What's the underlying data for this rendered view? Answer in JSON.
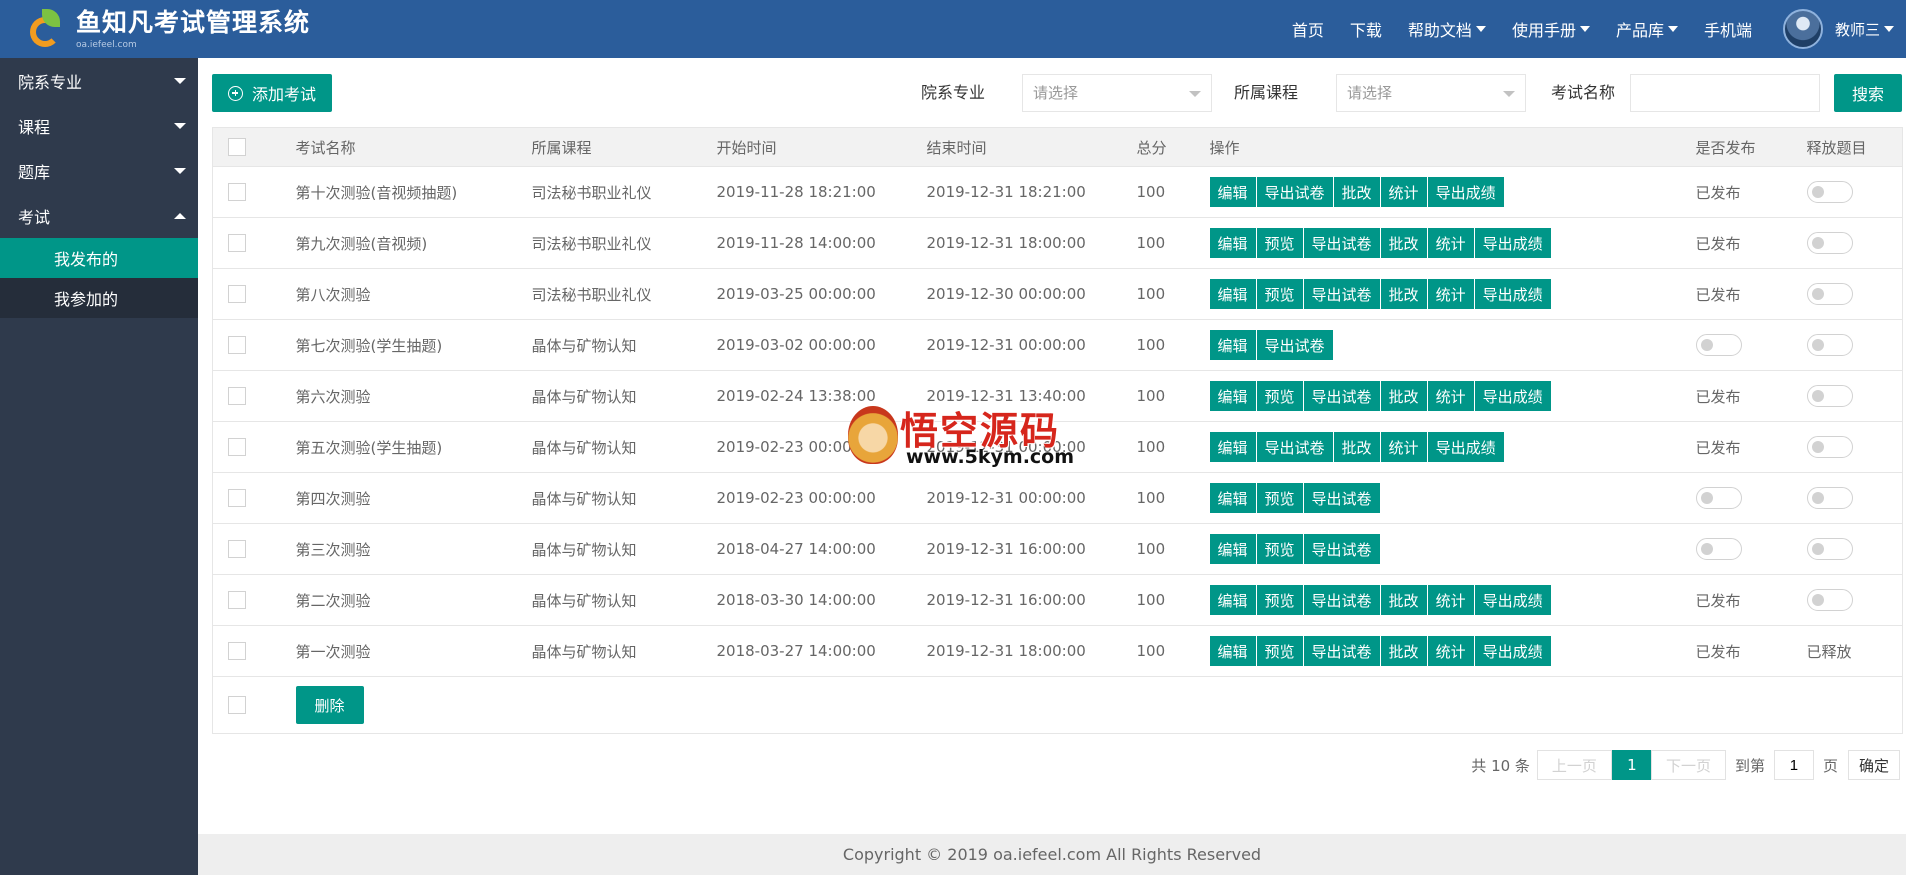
{
  "header": {
    "app_title": "鱼知凡考试管理系统",
    "app_subtitle": "oa.iefeel.com",
    "nav": [
      {
        "label": "首页",
        "dropdown": false
      },
      {
        "label": "下载",
        "dropdown": false
      },
      {
        "label": "帮助文档",
        "dropdown": true
      },
      {
        "label": "使用手册",
        "dropdown": true
      },
      {
        "label": "产品库",
        "dropdown": true
      },
      {
        "label": "手机端",
        "dropdown": false
      }
    ],
    "user_name": "教师三"
  },
  "sidebar": {
    "groups": [
      {
        "label": "院系专业",
        "expanded": false
      },
      {
        "label": "课程",
        "expanded": false
      },
      {
        "label": "题库",
        "expanded": false
      },
      {
        "label": "考试",
        "expanded": true
      }
    ],
    "sub_items": [
      {
        "label": "我发布的",
        "active": true
      },
      {
        "label": "我参加的",
        "active": false
      }
    ]
  },
  "toolbar": {
    "add_label": "添加考试",
    "dept_label": "院系专业",
    "dept_placeholder": "请选择",
    "course_label": "所属课程",
    "course_placeholder": "请选择",
    "name_label": "考试名称",
    "name_value": "",
    "search_label": "搜索"
  },
  "table": {
    "headers": [
      "考试名称",
      "所属课程",
      "开始时间",
      "结束时间",
      "总分",
      "操作",
      "是否发布",
      "释放题目"
    ],
    "rows": [
      {
        "name": "第十次测验(音视频抽题)",
        "course": "司法秘书职业礼仪",
        "start": "2019-11-28 18:21:00",
        "end": "2019-12-31 18:21:00",
        "score": "100",
        "ops": [
          "编辑",
          "导出试卷",
          "批改",
          "统计",
          "导出成绩"
        ],
        "published": "已发布",
        "released": ""
      },
      {
        "name": "第九次测验(音视频)",
        "course": "司法秘书职业礼仪",
        "start": "2019-11-28 14:00:00",
        "end": "2019-12-31 18:00:00",
        "score": "100",
        "ops": [
          "编辑",
          "预览",
          "导出试卷",
          "批改",
          "统计",
          "导出成绩"
        ],
        "published": "已发布",
        "released": ""
      },
      {
        "name": "第八次测验",
        "course": "司法秘书职业礼仪",
        "start": "2019-03-25 00:00:00",
        "end": "2019-12-30 00:00:00",
        "score": "100",
        "ops": [
          "编辑",
          "预览",
          "导出试卷",
          "批改",
          "统计",
          "导出成绩"
        ],
        "published": "已发布",
        "released": ""
      },
      {
        "name": "第七次测验(学生抽题)",
        "course": "晶体与矿物认知",
        "start": "2019-03-02 00:00:00",
        "end": "2019-12-31 00:00:00",
        "score": "100",
        "ops": [
          "编辑",
          "导出试卷"
        ],
        "published": "",
        "released": ""
      },
      {
        "name": "第六次测验",
        "course": "晶体与矿物认知",
        "start": "2019-02-24 13:38:00",
        "end": "2019-12-31 13:40:00",
        "score": "100",
        "ops": [
          "编辑",
          "预览",
          "导出试卷",
          "批改",
          "统计",
          "导出成绩"
        ],
        "published": "已发布",
        "released": ""
      },
      {
        "name": "第五次测验(学生抽题)",
        "course": "晶体与矿物认知",
        "start": "2019-02-23 00:00:00",
        "end": "2019-12-31 00:00:00",
        "score": "100",
        "ops": [
          "编辑",
          "导出试卷",
          "批改",
          "统计",
          "导出成绩"
        ],
        "published": "已发布",
        "released": ""
      },
      {
        "name": "第四次测验",
        "course": "晶体与矿物认知",
        "start": "2019-02-23 00:00:00",
        "end": "2019-12-31 00:00:00",
        "score": "100",
        "ops": [
          "编辑",
          "预览",
          "导出试卷"
        ],
        "published": "",
        "released": ""
      },
      {
        "name": "第三次测验",
        "course": "晶体与矿物认知",
        "start": "2018-04-27 14:00:00",
        "end": "2019-12-31 16:00:00",
        "score": "100",
        "ops": [
          "编辑",
          "预览",
          "导出试卷"
        ],
        "published": "",
        "released": ""
      },
      {
        "name": "第二次测验",
        "course": "晶体与矿物认知",
        "start": "2018-03-30 14:00:00",
        "end": "2019-12-31 16:00:00",
        "score": "100",
        "ops": [
          "编辑",
          "预览",
          "导出试卷",
          "批改",
          "统计",
          "导出成绩"
        ],
        "published": "已发布",
        "released": ""
      },
      {
        "name": "第一次测验",
        "course": "晶体与矿物认知",
        "start": "2018-03-27 14:00:00",
        "end": "2019-12-31 18:00:00",
        "score": "100",
        "ops": [
          "编辑",
          "预览",
          "导出试卷",
          "批改",
          "统计",
          "导出成绩"
        ],
        "published": "已发布",
        "released": "已释放"
      }
    ],
    "delete_label": "删除"
  },
  "pager": {
    "total_text": "共 10 条",
    "prev_label": "上一页",
    "current_page": "1",
    "next_label": "下一页",
    "goto_label": "到第",
    "goto_value": "1",
    "page_unit": "页",
    "confirm_label": "确定"
  },
  "footer": {
    "copyright": "Copyright © 2019 oa.iefeel.com All Rights Reserved"
  },
  "watermark": {
    "title": "悟空源码",
    "url": "www.5kym.com"
  },
  "colors": {
    "header_bg": "#2b5d9b",
    "sidebar_bg": "#2f3a4c",
    "accent": "#009688"
  }
}
